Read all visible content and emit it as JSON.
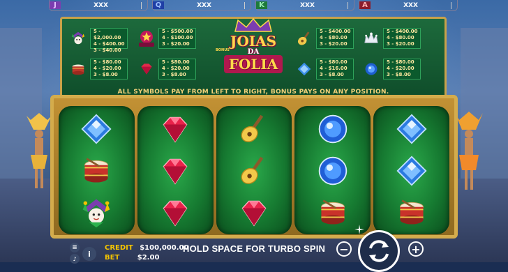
{
  "top_bar": {
    "pills": [
      {
        "letter": "J",
        "value": "XXX",
        "color": "#7b3db0",
        "letter_color": "#c39af0"
      },
      {
        "letter": "Q",
        "value": "XXX",
        "color": "#1f3fa6",
        "letter_color": "#6fa0ff"
      },
      {
        "letter": "K",
        "value": "XXX",
        "color": "#1e7a3a",
        "letter_color": "#5fd07c"
      },
      {
        "letter": "A",
        "value": "XXX",
        "color": "#8a1c2c",
        "letter_color": "#ff6b6b"
      }
    ]
  },
  "paytable": {
    "logo": {
      "line1": "JOIAS",
      "line2": "DA",
      "line3": "FOLIA"
    },
    "rows": [
      {
        "icon": "jester-icon",
        "values": [
          "5 - $2,000.00",
          "4 - $400.00",
          "3 - $40.00"
        ]
      },
      {
        "icon": "bonus-icon",
        "values": [
          "5 - $500.00",
          "4 - $100.00",
          "3 - $20.00"
        ]
      },
      {
        "icon": "guitar-icon",
        "values": [
          "5 - $400.00",
          "4 - $80.00",
          "3 - $20.00"
        ]
      },
      {
        "icon": "tiara-icon",
        "values": [
          "5 - $400.00",
          "4 - $80.00",
          "3 - $20.00"
        ]
      },
      {
        "icon": "drum-icon",
        "values": [
          "5 - $80.00",
          "4 - $20.00",
          "3 - $8.00"
        ]
      },
      {
        "icon": "red-gem-icon",
        "values": [
          "5 - $80.00",
          "4 - $20.00",
          "3 - $8.00"
        ]
      },
      {
        "icon": "diamond-gem-icon",
        "values": [
          "5 - $80.00",
          "4 - $16.00",
          "3 - $8.00"
        ]
      },
      {
        "icon": "blue-gem-icon",
        "values": [
          "5 - $80.00",
          "4 - $20.00",
          "3 - $8.00"
        ]
      }
    ],
    "bonus_label": "BONUS",
    "rule_text": "ALL SYMBOLS PAY FROM LEFT TO RIGHT, BONUS PAYS ON ANY POSITION."
  },
  "reels": [
    [
      "blue-diamond-icon",
      "drum-icon",
      "jester-icon"
    ],
    [
      "red-gem-icon",
      "red-gem-icon",
      "red-gem-icon"
    ],
    [
      "guitar-icon",
      "guitar-icon",
      "red-gem-icon"
    ],
    [
      "blue-gem-icon",
      "blue-gem-icon",
      "drum-icon"
    ],
    [
      "blue-diamond-icon",
      "blue-diamond-icon",
      "drum-icon"
    ]
  ],
  "bottom_bar": {
    "credit_label": "CREDIT",
    "credit_value": "$100,000.00",
    "bet_label": "BET",
    "bet_value": "$2.00",
    "turbo_text": "HOLD SPACE FOR TURBO SPIN",
    "minus": "−",
    "plus": "+",
    "info": "i"
  },
  "colors": {
    "gold": "#d4ac4c",
    "table_green": "#0f4d2a",
    "reel_green": "#167a31",
    "credit_yellow": "#f4c400"
  }
}
